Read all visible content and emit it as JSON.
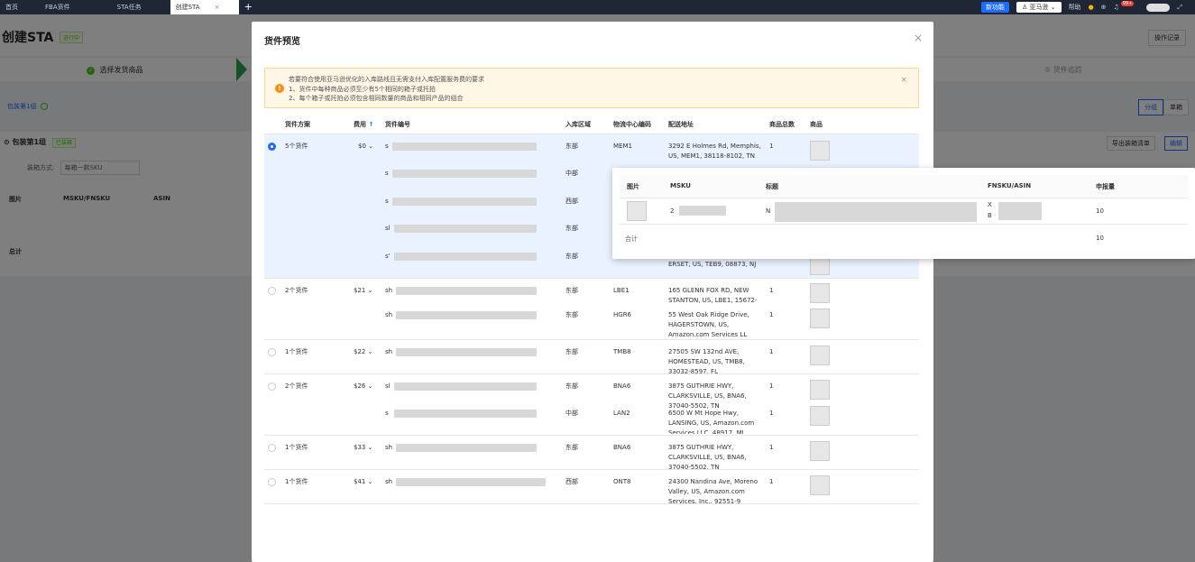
{
  "topbar": {
    "tabs": [
      {
        "label": "首页",
        "active": false
      },
      {
        "label": "FBA货件",
        "active": false
      },
      {
        "label": "STA任务",
        "active": false
      },
      {
        "label": "创建STA",
        "active": true
      }
    ],
    "close_glyph": "×",
    "add_glyph": "+",
    "new_feature_label": "新功能",
    "account_label": "亚马逊",
    "help_label": "帮助",
    "notification_count": "99+"
  },
  "page": {
    "title": "创建STA",
    "status": "进行中",
    "op_log_label": "操作记录",
    "step1_label": "选择发货商品",
    "step5_label": "⑤ 货件追踪",
    "package_tab": "包装第1组",
    "segment": [
      "分组",
      "单箱"
    ],
    "group_title": "包装第1组",
    "group_tag": "已装箱",
    "pack_way_label": "装箱方式:",
    "pack_way_value": "每箱一款SKU",
    "export_label": "导出装箱清单",
    "edit_label": "编辑",
    "columns": [
      "图片",
      "MSKU/FNSKU",
      "ASIN"
    ],
    "total_label": "总计"
  },
  "modal": {
    "title": "货件预览",
    "close_glyph": "×",
    "alert": {
      "line1": "若要符合使用亚马逊优化的入库路线且无需支付入库配置服务费的要求",
      "line2": "1、货件中每种商品必须至少有5个相同的箱子或托拍",
      "line3": "2、每个箱子或托拍必须包含相同数量的商品和相同产品的组合",
      "icon": "!",
      "close_glyph": "×"
    },
    "columns": [
      "货件方案",
      "费用",
      "货件编号",
      "入库区域",
      "物流中心编码",
      "配送地址",
      "商品总数",
      "商品"
    ],
    "sort_glyph": "↑",
    "rows": [
      {
        "plan": "5个货件",
        "fee": "$0",
        "selected": true,
        "items": [
          {
            "id_prefix": "s",
            "region": "东部",
            "fc": "MEM1",
            "addr": "3292 E Holmes Rd, Memphis, US, MEM1, 38118-8102, TN",
            "qty": "1"
          },
          {
            "id_prefix": "s",
            "region": "中部",
            "fc": "",
            "addr": "",
            "qty": ""
          },
          {
            "id_prefix": "s",
            "region": "西部",
            "fc": "",
            "addr": "",
            "qty": ""
          },
          {
            "id_prefix": "sl",
            "region": "东部",
            "fc": "",
            "addr": "",
            "qty": ""
          },
          {
            "id_prefix": "s'",
            "region": "东部",
            "fc": "",
            "addr": "ERSET, US, TEB9, 08873, NJ",
            "qty": ""
          }
        ]
      },
      {
        "plan": "2个货件",
        "fee": "$21",
        "selected": false,
        "items": [
          {
            "id_prefix": "sh",
            "region": "东部",
            "fc": "LBE1",
            "addr": "165 GLENN FOX RD, NEW STANTON, US, LBE1, 15672-9703, PA",
            "qty": "1"
          },
          {
            "id_prefix": "sh",
            "region": "东部",
            "fc": "HGR6",
            "addr": "55 West Oak Ridge Drive, HAGERSTOWN, US, Amazon.com Services LL",
            "qty": "1"
          }
        ]
      },
      {
        "plan": "1个货件",
        "fee": "$22",
        "selected": false,
        "items": [
          {
            "id_prefix": "sh",
            "region": "东部",
            "fc": "TMB8",
            "addr": "27505 SW 132nd AVE, HOMESTEAD, US, TMB8, 33032-8597, FL",
            "qty": "1"
          }
        ]
      },
      {
        "plan": "2个货件",
        "fee": "$26",
        "selected": false,
        "items": [
          {
            "id_prefix": "sl",
            "region": "东部",
            "fc": "BNA6",
            "addr": "3875 GUTHRIE HWY, CLARKSVILLE, US, BNA6, 37040-5502, TN",
            "qty": "1"
          },
          {
            "id_prefix": "s",
            "region": "中部",
            "fc": "LAN2",
            "addr": "6500 W Mt Hope Hwy, LANSING, US, Amazon.com Services LLC, 48917, MI",
            "qty": "1"
          }
        ]
      },
      {
        "plan": "1个货件",
        "fee": "$33",
        "selected": false,
        "items": [
          {
            "id_prefix": "sh",
            "region": "东部",
            "fc": "BNA6",
            "addr": "3875 GUTHRIE HWY, CLARKSVILLE, US, BNA6, 37040-5502, TN",
            "qty": "1"
          }
        ]
      },
      {
        "plan": "1个货件",
        "fee": "$41",
        "selected": false,
        "items": [
          {
            "id_prefix": "sh",
            "region": "西部",
            "fc": "ONT8",
            "addr": "24300 Nandina Ave, Moreno Valley, US, Amazon.com Services, Inc., 92551-9",
            "qty": "1"
          }
        ]
      }
    ]
  },
  "popover": {
    "columns": [
      "图片",
      "MSKU",
      "标题",
      "FNSKU/ASIN",
      "申报量"
    ],
    "row": {
      "msku_prefix": "2",
      "title_prefix": "N",
      "fnsku_prefix": "X",
      "asin_prefix": "B",
      "qty": "10"
    },
    "total_label": "合计",
    "total_qty": "10"
  },
  "colors": {
    "primary": "#1e6bff",
    "success": "#52c41a",
    "warning": "#fa8c16",
    "topbar": "#1f2636"
  }
}
